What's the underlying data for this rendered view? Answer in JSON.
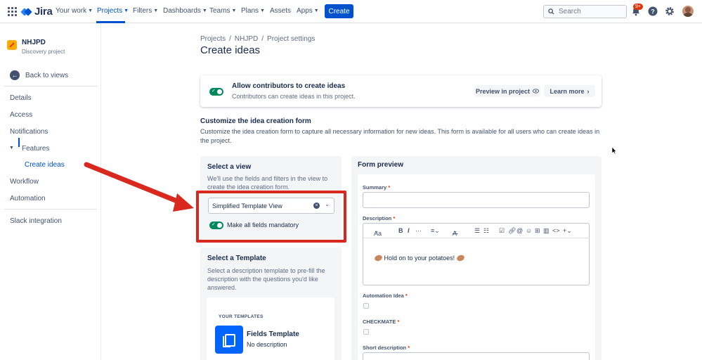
{
  "topnav": {
    "logo_text": "Jira",
    "items": [
      {
        "label": "Your work"
      },
      {
        "label": "Projects"
      },
      {
        "label": "Filters"
      },
      {
        "label": "Dashboards"
      },
      {
        "label": "Teams"
      },
      {
        "label": "Plans"
      },
      {
        "label": "Assets"
      },
      {
        "label": "Apps"
      }
    ],
    "create_label": "Create",
    "search_placeholder": "Search",
    "notification_badge": "9+"
  },
  "sidebar": {
    "project_name": "NHJPD",
    "project_type": "Discovery project",
    "back_label": "Back to views",
    "items": [
      {
        "label": "Details"
      },
      {
        "label": "Access"
      },
      {
        "label": "Notifications"
      },
      {
        "label": "Features"
      },
      {
        "label": "Create ideas"
      },
      {
        "label": "Workflow"
      },
      {
        "label": "Automation"
      },
      {
        "label": "Slack integration"
      }
    ]
  },
  "breadcrumbs": [
    "Projects",
    "NHJPD",
    "Project settings"
  ],
  "page_title": "Create ideas",
  "allow_card": {
    "title": "Allow contributors to create ideas",
    "subtitle": "Contributors can create ideas in this project.",
    "preview_label": "Preview in project",
    "learn_more_label": "Learn more",
    "enabled": true
  },
  "customize": {
    "title": "Customize the idea creation form",
    "description": "Customize the idea creation form to capture all necessary information for new ideas. This form is available for all users who can create ideas in the project."
  },
  "select_view": {
    "title": "Select a view",
    "description": "We'll use the fields and filters in the view to create the idea creation form.",
    "selected_value": "Simplified Template View",
    "mandatory_label": "Make all fields mandatory",
    "mandatory_enabled": true
  },
  "select_template": {
    "title": "Select a Template",
    "description": "Select a description template to pre-fill the description with the questions you'd like answered.",
    "section_label": "YOUR TEMPLATES",
    "template_name": "Fields Template",
    "template_desc": "No description"
  },
  "form_preview": {
    "title": "Form preview",
    "fields": {
      "summary": "Summary",
      "description": "Description",
      "automation_idea": "Automation Idea",
      "checkmate": "CHECKMATE",
      "short_description": "Short description"
    },
    "required_marker": "*",
    "toolbar_text_style": "Aa",
    "toolbar_bold": "B",
    "toolbar_italic": "I",
    "toolbar_more": "···",
    "toolbar_color": "A",
    "description_body": "Hold on to your potatoes!"
  },
  "colors": {
    "brand_blue": "#0052cc",
    "toggle_green": "#00875a",
    "annotation_red": "#d9281e",
    "badge_red": "#de350b"
  }
}
